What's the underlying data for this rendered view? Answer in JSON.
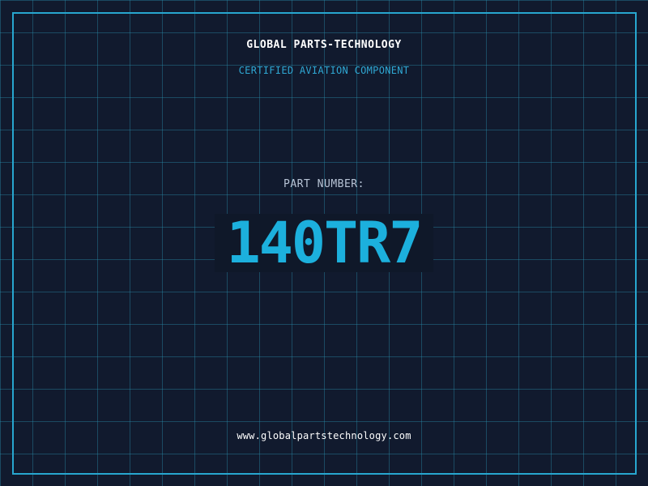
{
  "header": {
    "company_name": "GLOBAL PARTS-TECHNOLOGY",
    "subtitle": "CERTIFIED AVIATION COMPONENT"
  },
  "part": {
    "label": "PART NUMBER:",
    "number": "140TR7"
  },
  "footer": {
    "website": "www.globalpartstechnology.com"
  },
  "colors": {
    "background": "#111a2e",
    "grid": "#288caa",
    "frame": "#27a6cf",
    "accent": "#1cb0dd",
    "subtitle": "#2fa8d4",
    "label": "#b8c4d6",
    "text": "#ffffff"
  }
}
